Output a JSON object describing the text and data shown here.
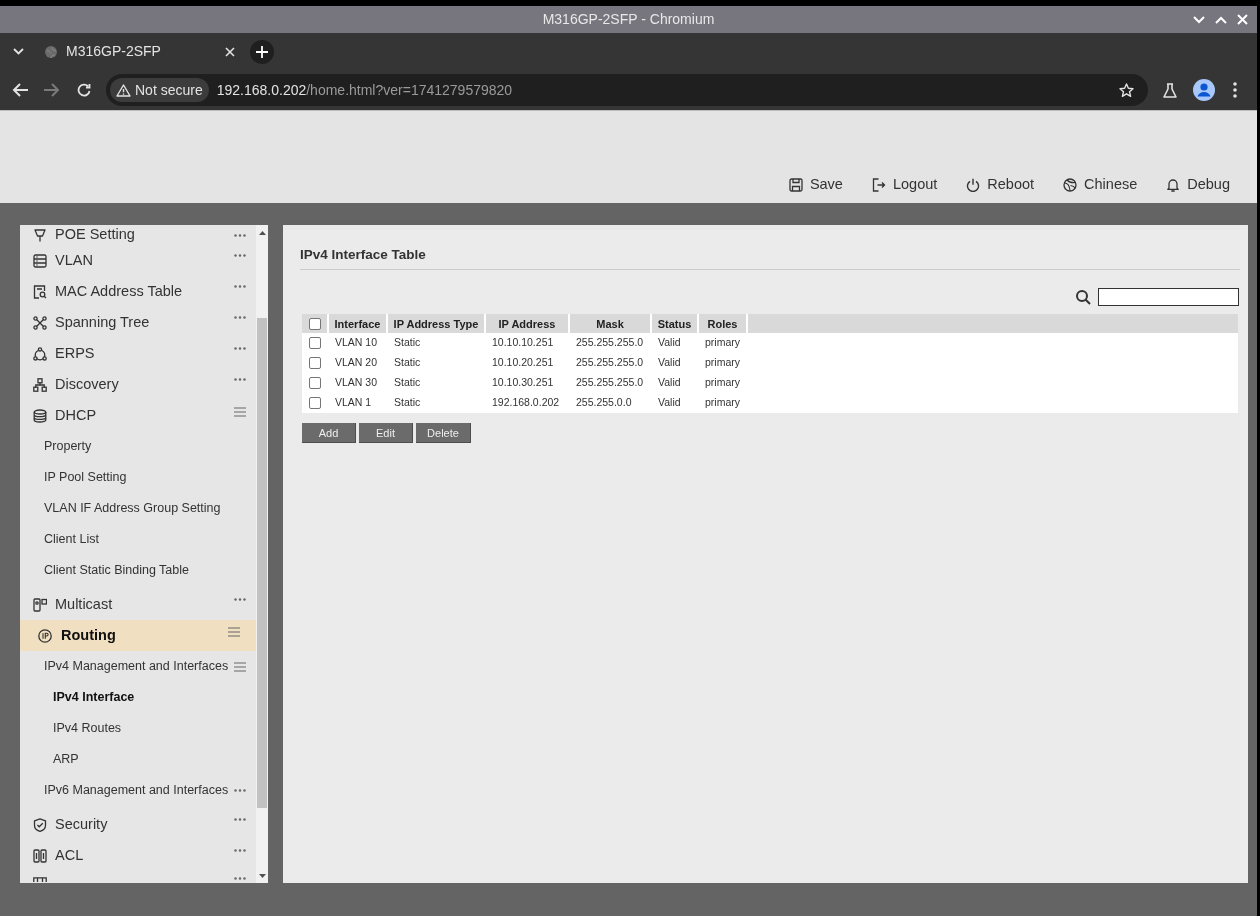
{
  "window": {
    "title": "M316GP-2SFP - Chromium"
  },
  "browser": {
    "tabs": [
      {
        "title": "M316GP-2SFP",
        "selected": true
      }
    ],
    "navigation": {
      "back_disabled": false,
      "forward_disabled": true
    },
    "address_bar": {
      "security_chip": "Not secure",
      "host": "192.168.0.202",
      "path": "/home.html?ver=1741279579820"
    }
  },
  "header_actions": [
    "Save",
    "Logout",
    "Reboot",
    "Chinese",
    "Debug"
  ],
  "sidebar": {
    "items": [
      {
        "label": "POE Setting",
        "selected": false,
        "expanded": false
      },
      {
        "label": "VLAN",
        "selected": false,
        "expanded": false
      },
      {
        "label": "MAC Address Table",
        "selected": false,
        "expanded": false
      },
      {
        "label": "Spanning Tree",
        "selected": false,
        "expanded": false
      },
      {
        "label": "ERPS",
        "selected": false,
        "expanded": false
      },
      {
        "label": "Discovery",
        "selected": false,
        "expanded": false
      },
      {
        "label": "DHCP",
        "selected": false,
        "expanded": true,
        "children": [
          {
            "label": "Property",
            "selected": false
          },
          {
            "label": "IP Pool Setting",
            "selected": false
          },
          {
            "label": "VLAN IF Address Group Setting",
            "selected": false
          },
          {
            "label": "Client List",
            "selected": false
          },
          {
            "label": "Client Static Binding Table",
            "selected": false
          }
        ]
      },
      {
        "label": "Multicast",
        "selected": false,
        "expanded": false
      },
      {
        "label": "Routing",
        "selected": true,
        "expanded": true,
        "children": [
          {
            "label": "IPv4 Management and Interfaces",
            "selected": false,
            "expanded": true,
            "children": [
              {
                "label": "IPv4 Interface",
                "selected": true
              },
              {
                "label": "IPv4 Routes",
                "selected": false
              },
              {
                "label": "ARP",
                "selected": false
              }
            ]
          },
          {
            "label": "IPv6 Management and Interfaces",
            "selected": false,
            "expanded": false
          }
        ]
      },
      {
        "label": "Security",
        "selected": false,
        "expanded": false
      },
      {
        "label": "ACL",
        "selected": false,
        "expanded": false
      },
      {
        "selected": false,
        "expanded": false
      }
    ]
  },
  "content": {
    "title": "IPv4 Interface Table",
    "table": {
      "select_all_checked": false,
      "columns": [
        "Interface",
        "IP Address Type",
        "IP Address",
        "Mask",
        "Status",
        "Roles"
      ],
      "rows": [
        {
          "checked": false,
          "cells": [
            "VLAN 10",
            "Static",
            "10.10.10.251",
            "255.255.255.0",
            "Valid",
            "primary"
          ]
        },
        {
          "checked": false,
          "cells": [
            "VLAN 20",
            "Static",
            "10.10.20.251",
            "255.255.255.0",
            "Valid",
            "primary"
          ]
        },
        {
          "checked": false,
          "cells": [
            "VLAN 30",
            "Static",
            "10.10.30.251",
            "255.255.255.0",
            "Valid",
            "primary"
          ]
        },
        {
          "checked": false,
          "cells": [
            "VLAN 1",
            "Static",
            "192.168.0.202",
            "255.255.0.0",
            "Valid",
            "primary"
          ]
        }
      ]
    },
    "buttons": [
      "Add",
      "Edit",
      "Delete"
    ]
  }
}
